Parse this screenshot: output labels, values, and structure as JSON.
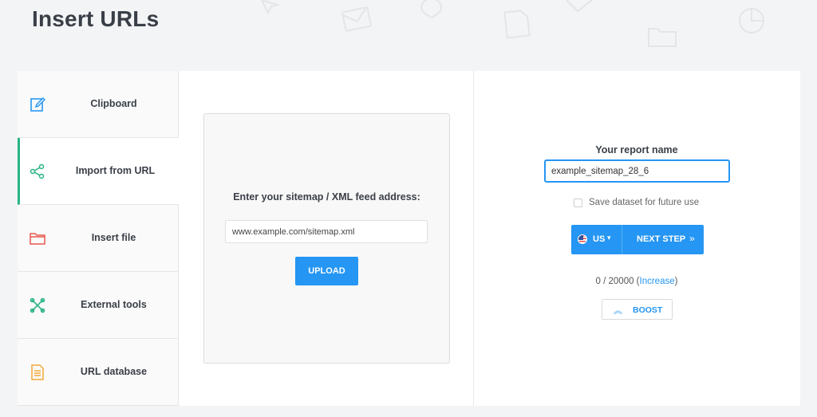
{
  "page": {
    "title": "Insert URLs"
  },
  "sidebar": {
    "items": [
      {
        "label": "Clipboard",
        "icon": "edit-icon",
        "color": "#2596f3"
      },
      {
        "label": "Import from URL",
        "icon": "share-icon",
        "color": "#28b485",
        "active": true
      },
      {
        "label": "Insert file",
        "icon": "folder-icon",
        "color": "#e8584d"
      },
      {
        "label": "External tools",
        "icon": "tools-icon",
        "color": "#28b485"
      },
      {
        "label": "URL database",
        "icon": "document-icon",
        "color": "#f2a93b"
      }
    ]
  },
  "import": {
    "label": "Enter your sitemap / XML feed address:",
    "url_value": "www.example.com/sitemap.xml",
    "upload_label": "UPLOAD"
  },
  "report": {
    "name_label": "Your report name",
    "name_value": "example_sitemap_28_6",
    "save_label": "Save dataset for future use",
    "country_label": "US",
    "next_label": "NEXT STEP",
    "quota_text": "0 / 20000 (",
    "increase_label": "Increase",
    "quota_close": ")",
    "boost_label": "BOOST"
  },
  "colors": {
    "accent": "#2596f3",
    "active": "#28b485",
    "background": "#f3f4f6"
  }
}
